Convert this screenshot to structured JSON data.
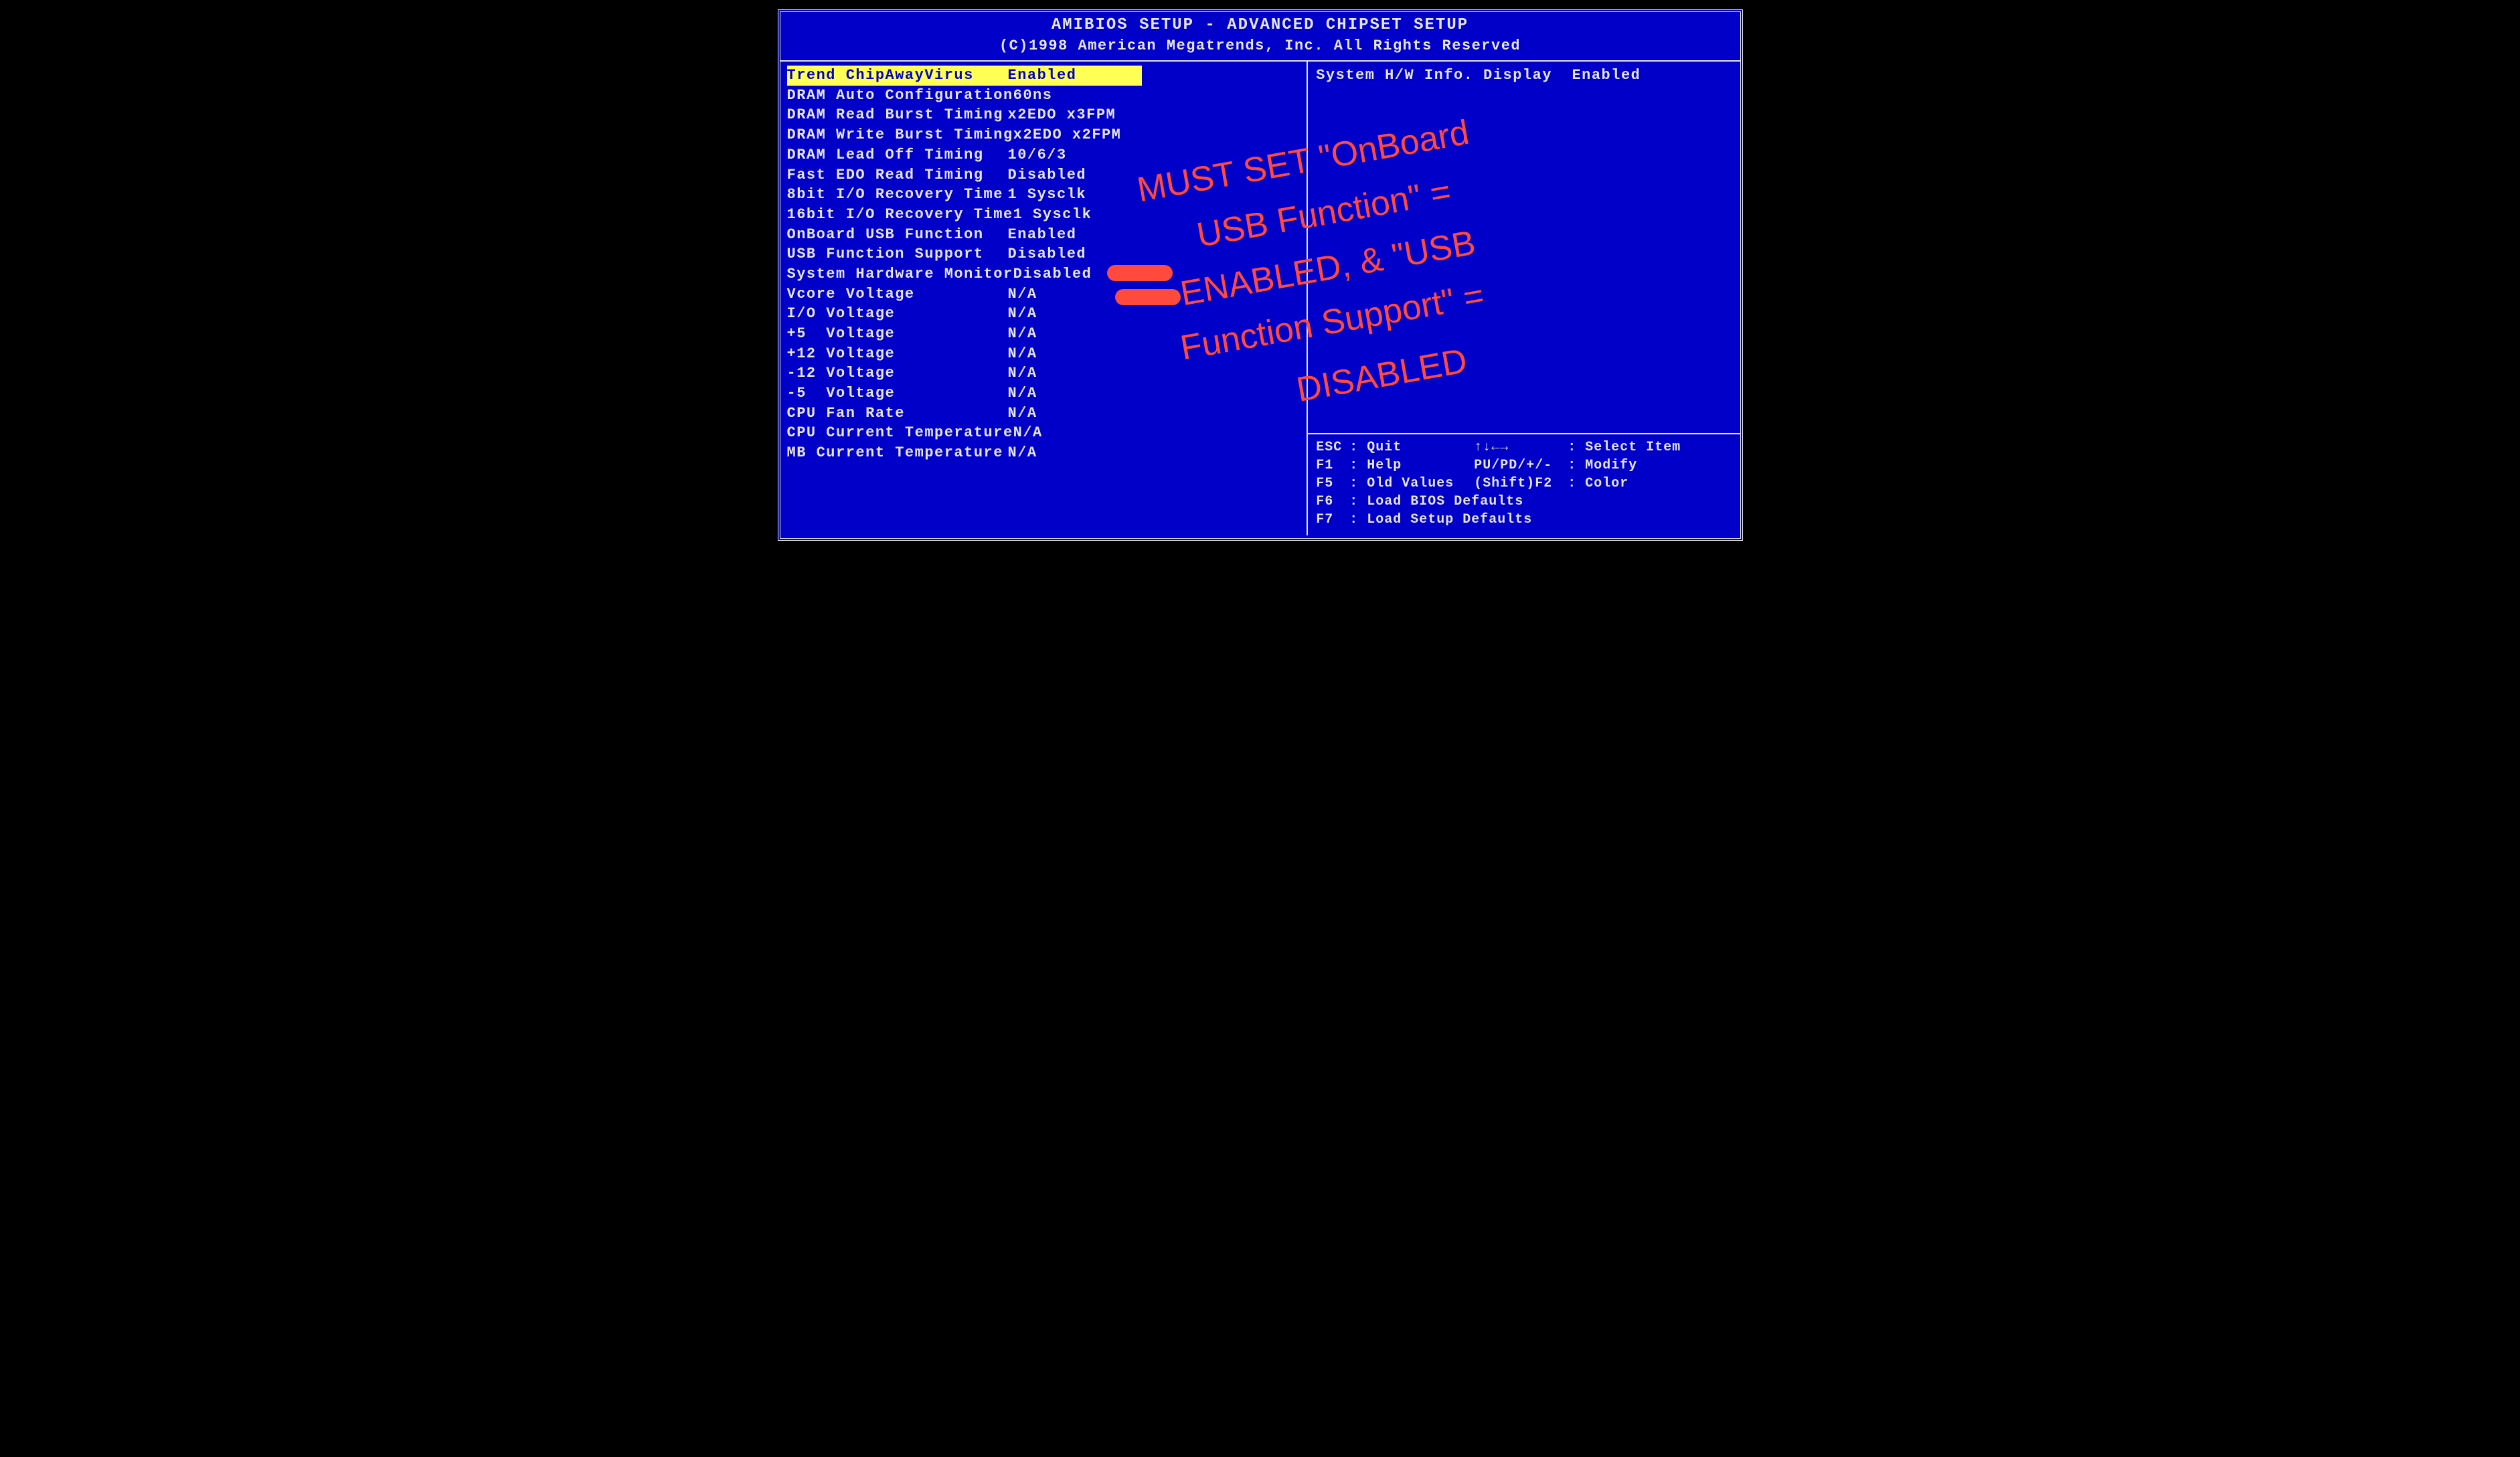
{
  "header": {
    "title": "AMIBIOS SETUP - ADVANCED CHIPSET SETUP",
    "copyright": "(C)1998 American Megatrends, Inc. All Rights Reserved"
  },
  "settings": [
    {
      "label": "Trend ChipAwayVirus",
      "value": "Enabled",
      "selected": true
    },
    {
      "label": "DRAM Auto Configuration",
      "value": "60ns",
      "selected": false
    },
    {
      "label": "DRAM Read Burst Timing",
      "value": "x2EDO x3FPM",
      "selected": false
    },
    {
      "label": "DRAM Write Burst Timing",
      "value": "x2EDO x2FPM",
      "selected": false
    },
    {
      "label": "DRAM Lead Off Timing",
      "value": "10/6/3",
      "selected": false
    },
    {
      "label": "Fast EDO Read Timing",
      "value": "Disabled",
      "selected": false
    },
    {
      "label": "8bit I/O Recovery Time",
      "value": "1 Sysclk",
      "selected": false
    },
    {
      "label": "16bit I/O Recovery Time",
      "value": "1 Sysclk",
      "selected": false
    },
    {
      "label": "OnBoard USB Function",
      "value": "Enabled",
      "selected": false
    },
    {
      "label": "USB Function Support",
      "value": "Disabled",
      "selected": false
    },
    {
      "label": "System Hardware Monitor",
      "value": "Disabled",
      "selected": false
    },
    {
      "label": "Vcore Voltage",
      "value": "N/A",
      "selected": false
    },
    {
      "label": "I/O Voltage",
      "value": "N/A",
      "selected": false
    },
    {
      "label": "+5  Voltage",
      "value": "N/A",
      "selected": false
    },
    {
      "label": "+12 Voltage",
      "value": "N/A",
      "selected": false
    },
    {
      "label": "-12 Voltage",
      "value": "N/A",
      "selected": false
    },
    {
      "label": "-5  Voltage",
      "value": "N/A",
      "selected": false
    },
    {
      "label": "CPU Fan Rate",
      "value": "N/A",
      "selected": false
    },
    {
      "label": "CPU Current Temperature",
      "value": "N/A",
      "selected": false
    },
    {
      "label": "MB Current Temperature",
      "value": "N/A",
      "selected": false
    }
  ],
  "right_top": {
    "label": "System H/W Info. Display",
    "value": "Enabled"
  },
  "help": [
    {
      "k1": "ESC",
      "a1": "Quit",
      "k2": "↑↓←→",
      "a2": "Select Item"
    },
    {
      "k1": "F1",
      "a1": "Help",
      "k2": "PU/PD/+/-",
      "a2": "Modify"
    },
    {
      "k1": "F5",
      "a1": "Old Values",
      "k2": "(Shift)F2",
      "a2": "Color"
    },
    {
      "k1": "F6",
      "a1": "Load BIOS Defaults",
      "k2": "",
      "a2": ""
    },
    {
      "k1": "F7",
      "a1": "Load Setup Defaults",
      "k2": "",
      "a2": ""
    }
  ],
  "annotation": {
    "line1": "MUST SET \"OnBoard",
    "line2": "USB Function\" =",
    "line3": "ENABLED, & \"USB",
    "line4": "Function Support\" =",
    "line5": "DISABLED"
  }
}
